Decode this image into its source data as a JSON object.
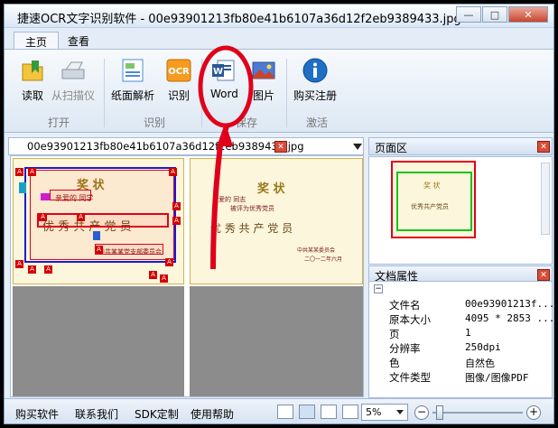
{
  "window": {
    "title": "捷速OCR文字识别软件 - 00e93901213fb80e41b6107a36d12f2eb9389433.jpg",
    "minimize": "—",
    "maximize": "□",
    "close": "✕"
  },
  "tabs": [
    "主页",
    "查看"
  ],
  "ribbon": {
    "buttons": [
      {
        "label": "读取",
        "icon": "folder-open-icon"
      },
      {
        "label": "从扫描仪",
        "icon": "scanner-icon"
      },
      {
        "label": "纸面解析",
        "icon": "page-analysis-icon"
      },
      {
        "label": "识别",
        "icon": "ocr-icon"
      },
      {
        "label": "Word",
        "icon": "word-icon"
      },
      {
        "label": "图片",
        "icon": "image-icon"
      },
      {
        "label": "购买注册",
        "icon": "info-icon"
      }
    ],
    "groups": [
      "打开",
      "识别",
      "保存",
      "激活"
    ]
  },
  "document": {
    "tab_label": "00e93901213fb80e41b6107a36d12f2eb9389433.jpg",
    "close": "✕",
    "left_page": {
      "title": "奖 状",
      "line1": "亲爱的 同学",
      "line2": "优 秀 共 产 党 员",
      "line3": "中共某某党支部委员会"
    },
    "right_page": {
      "title": "奖 状",
      "line1": "亲爱的 同志",
      "line2": "被评为优秀党员",
      "line3": "优 秀 共 产 党 员",
      "line4": "中共某某委员会",
      "line5": "二〇一二年六月"
    }
  },
  "pages_panel": {
    "title": "页面区",
    "close": "✕",
    "thumb_title": "奖 状",
    "thumb_text": "优秀共产党员"
  },
  "props_panel": {
    "title": "文档属性",
    "close": "✕",
    "collapse": "−",
    "rows": [
      {
        "key": "文件名",
        "value": "00e93901213f..."
      },
      {
        "key": "原本大小",
        "value": "4095 * 2853 ..."
      },
      {
        "key": "页",
        "value": "1"
      },
      {
        "key": "分辨率",
        "value": "250dpi"
      },
      {
        "key": "色",
        "value": "自然色"
      },
      {
        "key": "文件类型",
        "value": "图像/图像PDF"
      }
    ]
  },
  "statusbar": {
    "links": [
      "购买软件",
      "联系我们",
      "SDK定制",
      "使用帮助"
    ],
    "zoom": "5%",
    "zoom_out": "−",
    "zoom_in": "+",
    "zoom_level": 0.05
  },
  "colors": {
    "accent": "#1f5fa8",
    "annotation_red": "#e0001a",
    "selection_green": "#19c219",
    "selection_red": "#e0001a",
    "highlight_blue": "#1a1ad4"
  }
}
